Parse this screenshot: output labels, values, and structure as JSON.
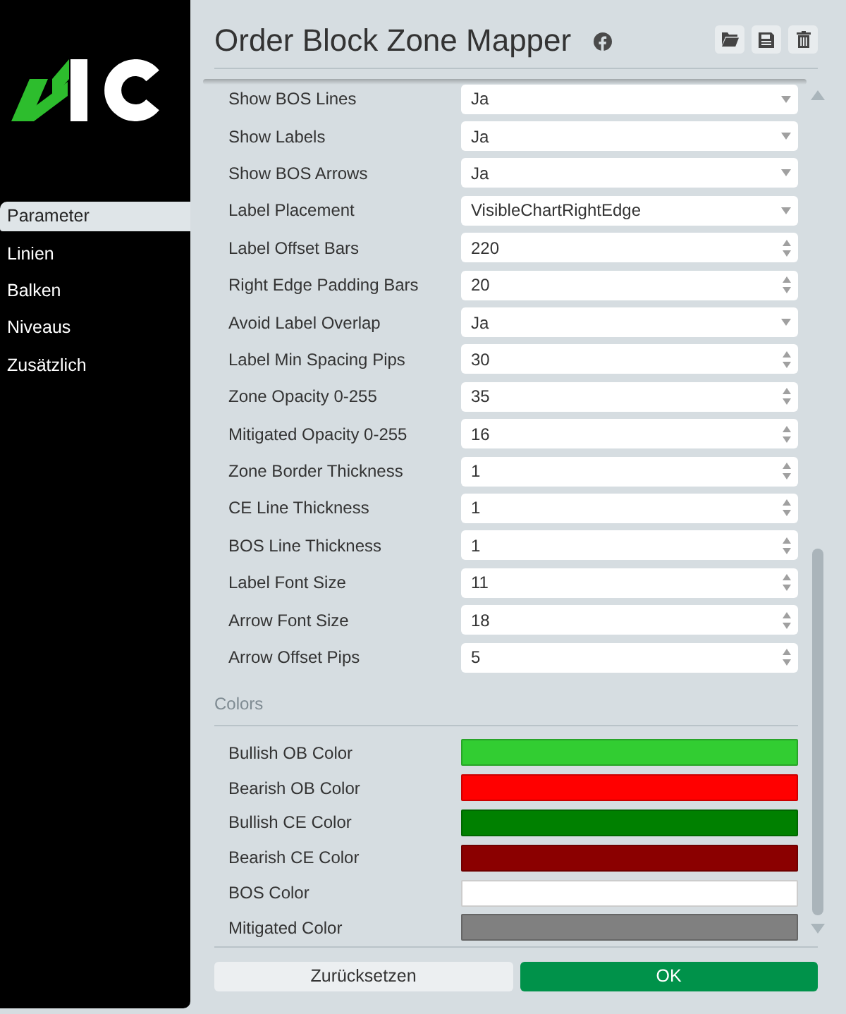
{
  "sidebar": {
    "items": [
      {
        "label": "Parameter",
        "selected": true
      },
      {
        "label": "Linien",
        "selected": false
      },
      {
        "label": "Balken",
        "selected": false
      },
      {
        "label": "Niveaus",
        "selected": false
      },
      {
        "label": "Zusätzlich",
        "selected": false
      }
    ]
  },
  "header": {
    "title": "Order Block Zone Mapper"
  },
  "parameters": [
    {
      "label": "Show BOS Lines",
      "kind": "select",
      "value": "Ja"
    },
    {
      "label": "Show Labels",
      "kind": "select",
      "value": "Ja"
    },
    {
      "label": "Show BOS Arrows",
      "kind": "select",
      "value": "Ja"
    },
    {
      "label": "Label Placement",
      "kind": "select",
      "value": "VisibleChartRightEdge"
    },
    {
      "label": "Label Offset Bars",
      "kind": "number",
      "value": "220"
    },
    {
      "label": "Right Edge Padding Bars",
      "kind": "number",
      "value": "20"
    },
    {
      "label": "Avoid Label Overlap",
      "kind": "select",
      "value": "Ja"
    },
    {
      "label": "Label Min Spacing Pips",
      "kind": "number",
      "value": "30"
    },
    {
      "label": "Zone Opacity 0-255",
      "kind": "number",
      "value": "35"
    },
    {
      "label": "Mitigated Opacity 0-255",
      "kind": "number",
      "value": "16"
    },
    {
      "label": "Zone Border Thickness",
      "kind": "number",
      "value": "1"
    },
    {
      "label": "CE Line Thickness",
      "kind": "number",
      "value": "1"
    },
    {
      "label": "BOS Line Thickness",
      "kind": "number",
      "value": "1"
    },
    {
      "label": "Label Font Size",
      "kind": "number",
      "value": "11"
    },
    {
      "label": "Arrow Font Size",
      "kind": "number",
      "value": "18"
    },
    {
      "label": "Arrow Offset Pips",
      "kind": "number",
      "value": "5"
    }
  ],
  "colors": {
    "title": "Colors",
    "items": [
      {
        "label": "Bullish OB Color",
        "color": "#32cd32"
      },
      {
        "label": "Bearish OB Color",
        "color": "#ff0000"
      },
      {
        "label": "Bullish CE Color",
        "color": "#008000"
      },
      {
        "label": "Bearish CE Color",
        "color": "#8b0000"
      },
      {
        "label": "BOS Color",
        "color": "#ffffff"
      },
      {
        "label": "Mitigated Color",
        "color": "#808080"
      }
    ]
  },
  "buttons": [
    {
      "label": "Zurücksetzen",
      "kind": "secondary"
    },
    {
      "label": "OK",
      "kind": "primary"
    }
  ]
}
